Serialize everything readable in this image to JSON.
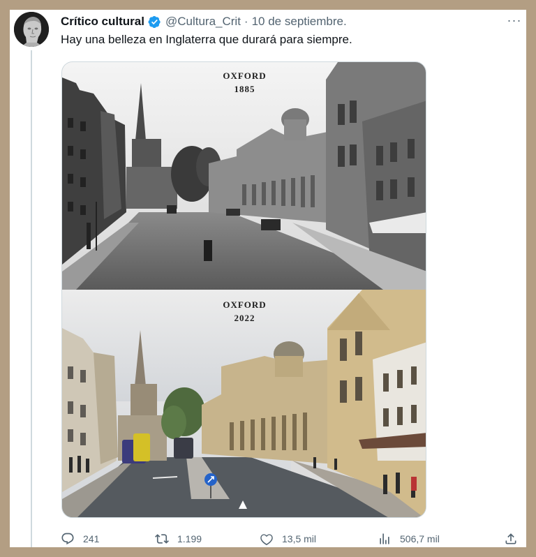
{
  "tweet": {
    "author_name": "Crítico cultural",
    "handle": "@Cultura_Crit",
    "separator": "·",
    "date": "10 de septiembre.",
    "more_label": "···",
    "text": "Hay una belleza en Inglaterra que durará para siempre.",
    "verified": true
  },
  "media": {
    "top": {
      "city": "OXFORD",
      "year": "1885"
    },
    "bottom": {
      "city": "OXFORD",
      "year": "2022"
    }
  },
  "actions": {
    "replies": "241",
    "retweets": "1.199",
    "likes": "13,5 mil",
    "views": "506,7 mil"
  },
  "icons": [
    "verified-badge-icon",
    "more-icon",
    "reply-icon",
    "retweet-icon",
    "like-icon",
    "views-icon",
    "share-icon"
  ],
  "colors": {
    "background": "#b39e83",
    "card": "#ffffff",
    "verified": "#1d9bf0",
    "secondary_text": "#536471"
  }
}
